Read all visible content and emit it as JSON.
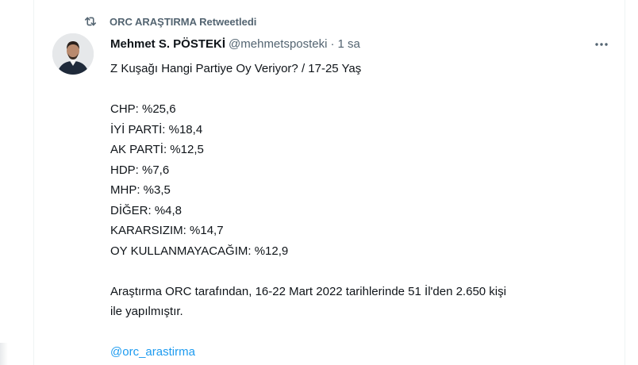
{
  "retweet": {
    "icon": "retweet-icon",
    "label": "ORC ARAŞTIRMA Retweetledi"
  },
  "tweet": {
    "author": {
      "name": "Mehmet S. PÖSTEKİ",
      "handle": "@mehmetsposteki",
      "separator": "·",
      "time": "1 sa"
    },
    "more_icon": "more-horizontal-icon",
    "title_line": "Z Kuşağı Hangi Partiye Oy Veriyor? / 17-25 Yaş",
    "results": [
      "CHP: %25,6",
      "İYİ PARTİ: %18,4",
      "AK PARTİ: %12,5",
      "HDP: %7,6",
      "MHP: %3,5",
      "DİĞER: %4,8",
      "KARARSIZIM: %14,7",
      "OY KULLANMAYACAĞIM: %12,9"
    ],
    "methodology_line1": "Araştırma ORC tarafından, 16-22 Mart 2022 tarihlerinde 51 İl'den 2.650 kişi",
    "methodology_line2": "ile yapılmıştır.",
    "mention": "@orc_arastirma"
  },
  "colors": {
    "text_primary": "#0f1419",
    "text_secondary": "#536471",
    "link": "#1d9bf0",
    "border": "#eff3f4"
  }
}
